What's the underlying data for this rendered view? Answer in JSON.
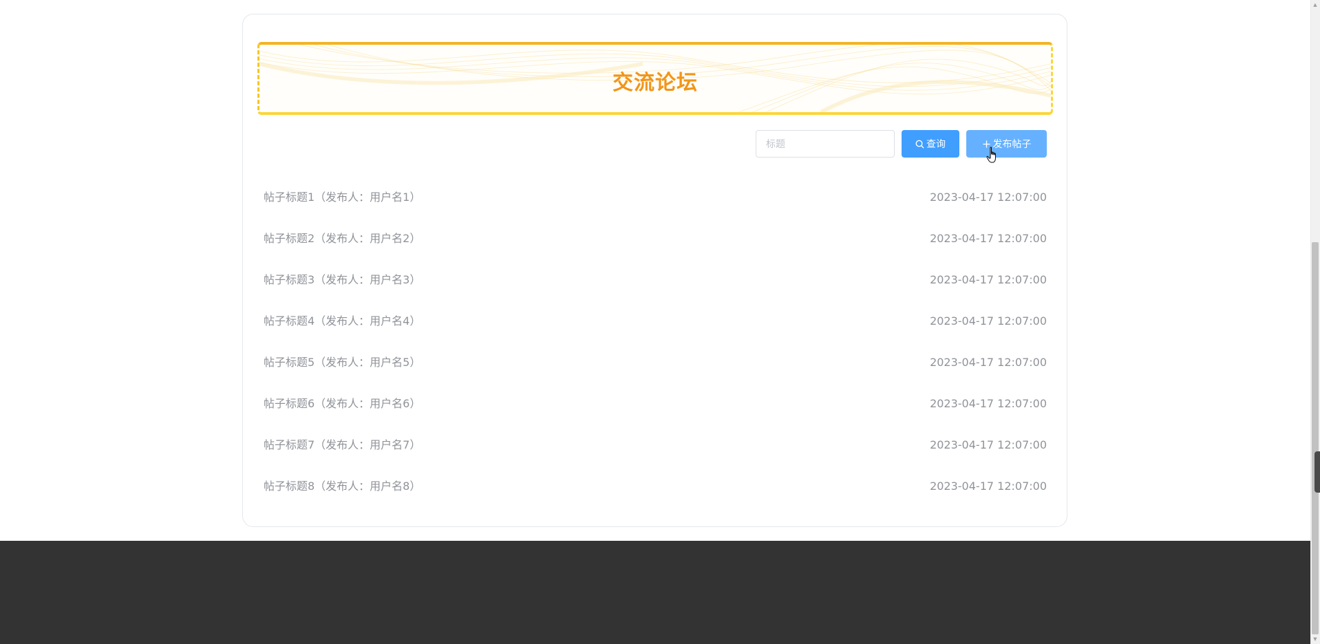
{
  "banner": {
    "title": "交流论坛",
    "accent_color": "#f29518"
  },
  "search": {
    "placeholder": "标题",
    "value": "",
    "search_label": "查询",
    "post_label": "发布帖子"
  },
  "posts": [
    {
      "title": "帖子标题1（发布人：用户名1）",
      "time": "2023-04-17 12:07:00"
    },
    {
      "title": "帖子标题2（发布人：用户名2）",
      "time": "2023-04-17 12:07:00"
    },
    {
      "title": "帖子标题3（发布人：用户名3）",
      "time": "2023-04-17 12:07:00"
    },
    {
      "title": "帖子标题4（发布人：用户名4）",
      "time": "2023-04-17 12:07:00"
    },
    {
      "title": "帖子标题5（发布人：用户名5）",
      "time": "2023-04-17 12:07:00"
    },
    {
      "title": "帖子标题6（发布人：用户名6）",
      "time": "2023-04-17 12:07:00"
    },
    {
      "title": "帖子标题7（发布人：用户名7）",
      "time": "2023-04-17 12:07:00"
    },
    {
      "title": "帖子标题8（发布人：用户名8）",
      "time": "2023-04-17 12:07:00"
    }
  ],
  "colors": {
    "primary_button": "#409eff",
    "primary_button_hover": "#66b1ff",
    "footer": "#333333",
    "list_text": "#909399"
  },
  "icons": {
    "search": "search-icon",
    "plus": "plus-icon",
    "cursor": "hand-pointer-icon"
  }
}
